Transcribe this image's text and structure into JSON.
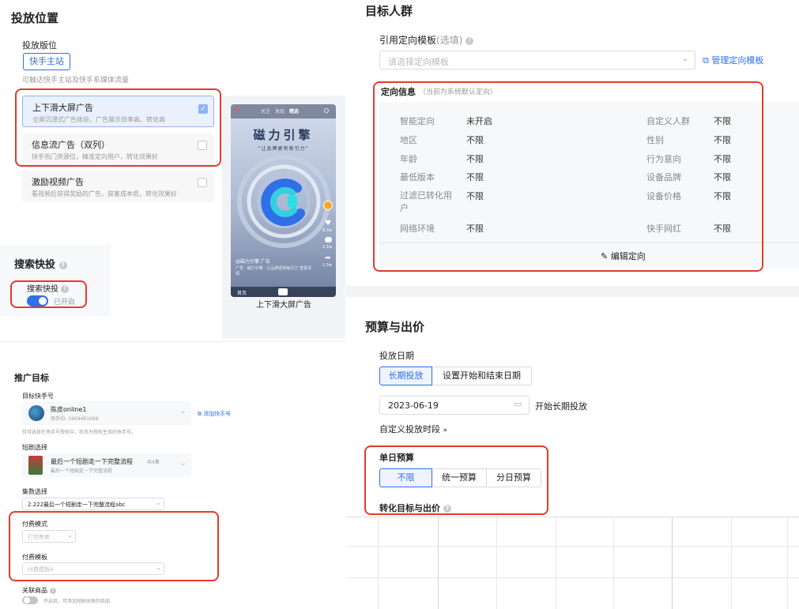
{
  "placement": {
    "title": "投放位置",
    "slot_label": "投放版位",
    "site_button": "快手主站",
    "site_hint": "可触达快手主站及快手系媒体流量",
    "options": [
      {
        "title": "上下滑大屏广告",
        "desc": "全屏沉浸式广告体验，广告展示效率高、转化高",
        "checked": true
      },
      {
        "title": "信息流广告（双列）",
        "desc": "快手热门资源位，精准定向用户，转化效果好",
        "checked": false
      },
      {
        "title": "激励视频广告",
        "desc": "看视频后获得奖励的广告，获客成本低，转化效果好",
        "checked": false
      }
    ],
    "preview": {
      "tabs": [
        "关注",
        "发现",
        "精选"
      ],
      "headline": "磁力引擎",
      "slogan": "“让品牌更有吸引力”",
      "caption": "@磁力引擎 广告",
      "caption2": "广告 · 磁力引擎 · 让品牌更有吸引力 查看详情",
      "bottom_left": "首页",
      "label": "上下滑大屏广告",
      "side_counts": [
        "8.3w",
        "2.1w",
        "1.5w"
      ]
    }
  },
  "search_boost": {
    "title": "搜索快投",
    "label": "搜索快投",
    "status": "已开启",
    "enabled": true
  },
  "target_audience": {
    "title": "目标人群",
    "template_label": "引用定向模板",
    "template_optional": "(选填)",
    "template_placeholder": "请选择定向模板",
    "manage_link": "管理定向模板",
    "info_title": "定向信息",
    "info_hint": "（当前为系统默认定向）",
    "rows_left": [
      {
        "label": "智能定向",
        "value": "未开启"
      },
      {
        "label": "地区",
        "value": "不限"
      },
      {
        "label": "年龄",
        "value": "不限"
      },
      {
        "label": "最低版本",
        "value": "不限"
      },
      {
        "label": "过滤已转化用户",
        "value": "不限"
      },
      {
        "label": "网络环境",
        "value": "不限"
      }
    ],
    "rows_right": [
      {
        "label": "自定义人群",
        "value": "不限"
      },
      {
        "label": "性别",
        "value": "不限"
      },
      {
        "label": "行为意向",
        "value": "不限"
      },
      {
        "label": "设备品牌",
        "value": "不限"
      },
      {
        "label": "设备价格",
        "value": "不限"
      },
      {
        "label": "快手网红",
        "value": "不限"
      }
    ],
    "edit_button": "编辑定向"
  },
  "promotion": {
    "title": "推广目标",
    "account_label": "目标快手号",
    "account_name": "陈皮online1",
    "account_id": "快手ID: 1904491069",
    "add_account": "添加快手号",
    "account_hint": "仅可选择在快手号授权中、状态为授权生效的快手号。",
    "drama_label": "短剧选择",
    "drama_name": "最后一个短剧走一下完整流程",
    "drama_count": "共4集",
    "drama_sub": "最后一个短剧走一下完整流程",
    "episode_label": "集数选择",
    "episode_value": "2.222最后一个短剧走一下完整流程abc",
    "pay_mode_label": "付费模式",
    "pay_mode_value": "打包售卖",
    "pay_template_label": "付费模板",
    "pay_template_value": "付费模板A",
    "linked_label": "关联商品",
    "linked_hint": "开启后，可添加短剧关联的商品"
  },
  "budget": {
    "title": "预算与出价",
    "date_label": "投放日期",
    "date_tabs": [
      "长期投放",
      "设置开始和结束日期"
    ],
    "start_date": "2023-06-19",
    "long_term": "开始长期投放",
    "custom_period": "自定义投放时段",
    "daily_label": "单日预算",
    "daily_tabs": [
      "不限",
      "统一预算",
      "分日预算"
    ],
    "conversion_label": "转化目标与出价"
  },
  "colors": {
    "accent": "#2f6fe8",
    "highlight": "#e23b2e",
    "toggle": "#2f6fe8"
  }
}
